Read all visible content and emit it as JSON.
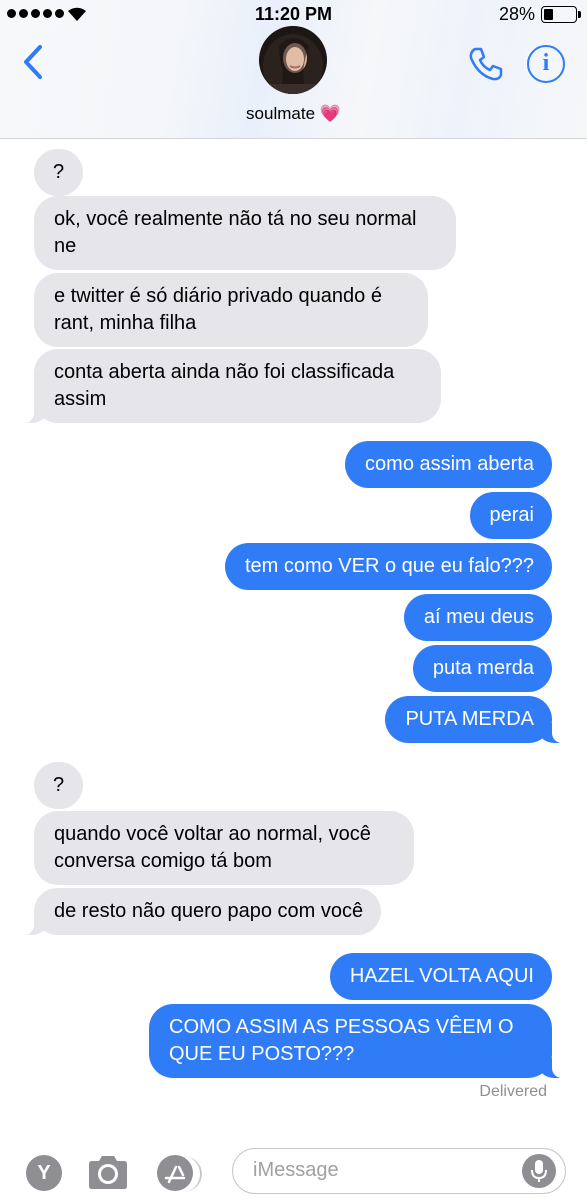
{
  "status_bar": {
    "time": "11:20 PM",
    "battery_percent": "28%",
    "battery_level": 0.28,
    "signal_bars": 5
  },
  "header": {
    "contact_name": "soulmate",
    "contact_emoji": "💗",
    "back_icon": "chevron-left-icon",
    "call_icon": "phone-icon",
    "info_icon": "info-icon",
    "info_glyph": "i",
    "accent_color": "#2f7cf6"
  },
  "messages": [
    {
      "from": "them",
      "text": "?"
    },
    {
      "from": "them",
      "text": "ok, você realmente não tá no seu normal\nne"
    },
    {
      "from": "them",
      "text": "e twitter é só diário privado quando é\nrant, minha filha"
    },
    {
      "from": "them",
      "text": "conta aberta ainda não foi classificada\nassim"
    },
    {
      "from": "me",
      "text": "como assim aberta"
    },
    {
      "from": "me",
      "text": "perai"
    },
    {
      "from": "me",
      "text": "tem como VER o que eu falo???"
    },
    {
      "from": "me",
      "text": "aí meu deus"
    },
    {
      "from": "me",
      "text": "puta merda"
    },
    {
      "from": "me",
      "text": "PUTA MERDA"
    },
    {
      "from": "them",
      "text": "?"
    },
    {
      "from": "them",
      "text": "quando você voltar ao normal, você\nconversa comigo tá bom"
    },
    {
      "from": "them",
      "text": "de resto não quero papo com você"
    },
    {
      "from": "me",
      "text": "HAZEL VOLTA AQUI"
    },
    {
      "from": "me",
      "text": "COMO ASSIM AS PESSOAS VÊEM O\nQUE EU POSTO???"
    }
  ],
  "delivered_label": "Delivered",
  "colors": {
    "sent_bubble": "#2f7cf6",
    "received_bubble": "#e5e5ea"
  },
  "toolbar": {
    "apps_glyph": "Y",
    "apps_icon": "apps-icon",
    "camera_icon": "camera-icon",
    "appstore_icon": "app-store-icon",
    "input_placeholder": "iMessage",
    "mic_icon": "microphone-icon"
  }
}
